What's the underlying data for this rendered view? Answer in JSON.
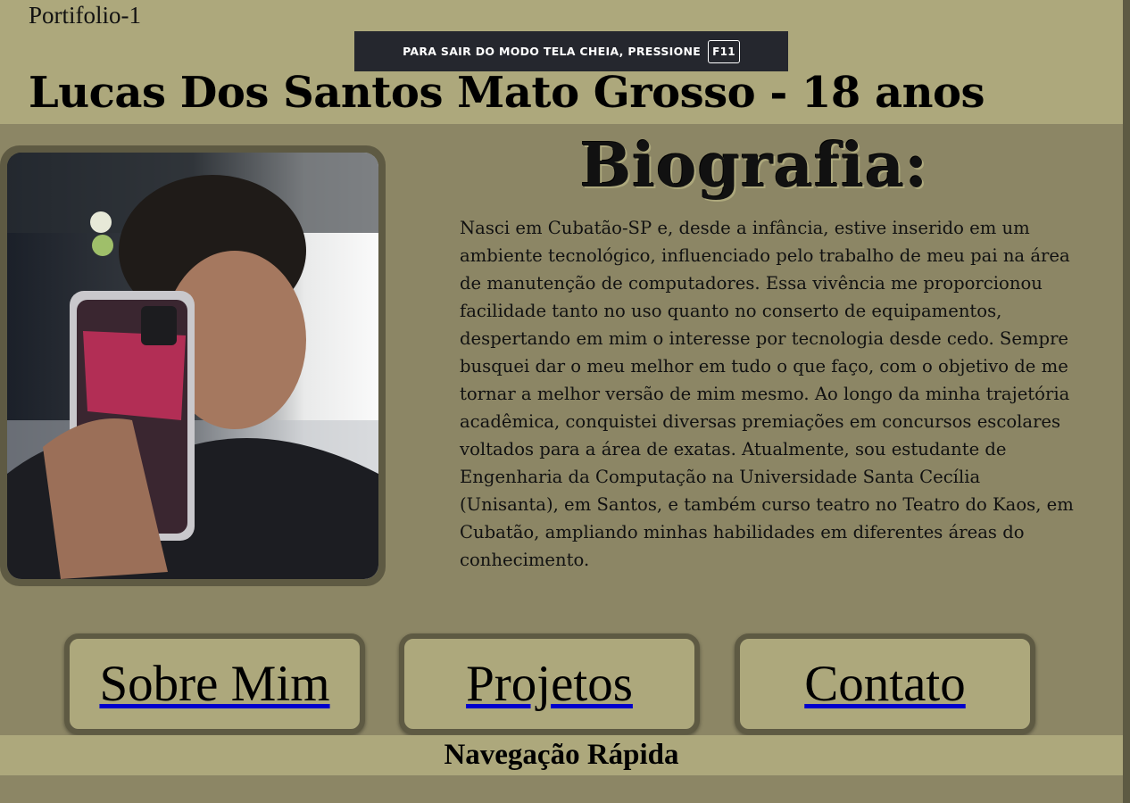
{
  "header": {
    "site_name": "Portifolio-1",
    "title": "Lucas Dos Santos Mato Grosso - 18 anos"
  },
  "fullscreen_notice": {
    "text": "PARA SAIR DO MODO TELA CHEIA, PRESSIONE",
    "key": "F11"
  },
  "profile": {
    "photo_icon": "profile-photo"
  },
  "biography": {
    "heading": "Biografia:",
    "text": "Nasci em Cubatão-SP e, desde a infância, estive inserido em um ambiente tecnológico, influenciado pelo trabalho de meu pai na área de manutenção de computadores. Essa vivência me proporcionou facilidade tanto no uso quanto no conserto de equipamentos, despertando em mim o interesse por tecnologia desde cedo. Sempre busquei dar o meu melhor em tudo o que faço, com o objetivo de me tornar a melhor versão de mim mesmo. Ao longo da minha trajetória acadêmica, conquistei diversas premiações em concursos escolares voltados para a área de exatas. Atualmente, sou estudante de Engenharia da Computação na Universidade Santa Cecília (Unisanta), em Santos, e também curso teatro no Teatro do Kaos, em Cubatão, ampliando minhas habilidades em diferentes áreas do conhecimento."
  },
  "nav": {
    "items": [
      {
        "label": "Sobre Mim"
      },
      {
        "label": "Projetos"
      },
      {
        "label": "Contato"
      }
    ],
    "footer_label": "Navegação Rápida"
  },
  "colors": {
    "page_bg": "#8c8665",
    "header_bg": "#ada87c",
    "frame": "#5e5a43",
    "link_underline": "#0000cc"
  }
}
